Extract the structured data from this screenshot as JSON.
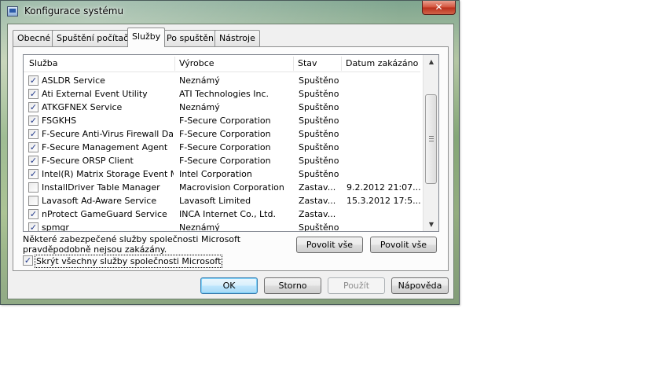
{
  "window": {
    "title": "Konfigurace systému",
    "close_glyph": "✕"
  },
  "tabs": [
    {
      "label": "Obecné",
      "active": false
    },
    {
      "label": "Spuštění počítače",
      "active": false
    },
    {
      "label": "Služby",
      "active": true
    },
    {
      "label": "Po spuštění",
      "active": false
    },
    {
      "label": "Nástroje",
      "active": false
    }
  ],
  "services": {
    "columns": [
      "Služba",
      "Výrobce",
      "Stav",
      "Datum zakázáno"
    ],
    "rows": [
      {
        "checked": true,
        "name": "ASLDR Service",
        "vendor": "Neznámý",
        "status": "Spuštěno",
        "date": ""
      },
      {
        "checked": true,
        "name": "Ati External Event Utility",
        "vendor": "ATI Technologies Inc.",
        "status": "Spuštěno",
        "date": ""
      },
      {
        "checked": true,
        "name": "ATKGFNEX Service",
        "vendor": "Neznámý",
        "status": "Spuštěno",
        "date": ""
      },
      {
        "checked": true,
        "name": "FSGKHS",
        "vendor": "F-Secure Corporation",
        "status": "Spuštěno",
        "date": ""
      },
      {
        "checked": true,
        "name": "F-Secure Anti-Virus Firewall Dae...",
        "vendor": "F-Secure Corporation",
        "status": "Spuštěno",
        "date": ""
      },
      {
        "checked": true,
        "name": "F-Secure Management Agent",
        "vendor": "F-Secure Corporation",
        "status": "Spuštěno",
        "date": ""
      },
      {
        "checked": true,
        "name": "F-Secure ORSP Client",
        "vendor": "F-Secure Corporation",
        "status": "Spuštěno",
        "date": ""
      },
      {
        "checked": true,
        "name": "Intel(R) Matrix Storage Event M...",
        "vendor": "Intel Corporation",
        "status": "Spuštěno",
        "date": ""
      },
      {
        "checked": false,
        "name": "InstallDriver Table Manager",
        "vendor": "Macrovision Corporation",
        "status": "Zastav...",
        "date": "9.2.2012 21:07..."
      },
      {
        "checked": false,
        "name": "Lavasoft Ad-Aware Service",
        "vendor": "Lavasoft Limited",
        "status": "Zastav...",
        "date": "15.3.2012 17:5..."
      },
      {
        "checked": true,
        "name": "nProtect GameGuard Service",
        "vendor": "INCA Internet Co., Ltd.",
        "status": "Zastav...",
        "date": ""
      },
      {
        "checked": true,
        "name": "spmgr",
        "vendor": "Neznámý",
        "status": "Spuštěno",
        "date": ""
      }
    ],
    "check_glyph": "✓"
  },
  "note": "Některé zabezpečené služby společnosti Microsoft pravděpodobně nejsou zakázány.",
  "enable_all_label": "Povolit vše",
  "disable_all_label": "Povolit vše",
  "hide_ms": {
    "label": "Skrýt všechny služby společnosti Microsoft",
    "checked": true
  },
  "buttons": {
    "ok": "OK",
    "cancel": "Storno",
    "apply": "Použít",
    "help": "Nápověda"
  }
}
